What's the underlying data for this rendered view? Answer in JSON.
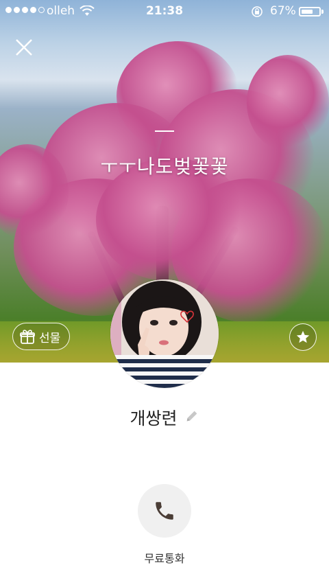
{
  "status_bar": {
    "carrier": "olleh",
    "time": "21:38",
    "battery_pct": "67%",
    "battery_level": 0.67,
    "signal_bars_filled": 4,
    "signal_bars_total": 5
  },
  "profile": {
    "status_message": "ㅜㅜ나도벚꽃꽃",
    "name": "개쌍련"
  },
  "actions": {
    "gift_label": "선물",
    "call_label": "무료통화"
  },
  "colors": {
    "call_icon": "#4a3d36",
    "name_text": "#222222"
  }
}
